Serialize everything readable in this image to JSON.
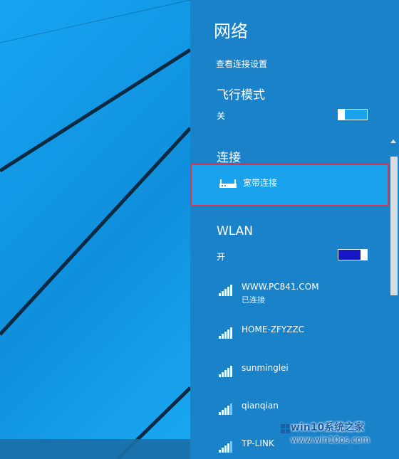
{
  "panel": {
    "title": "网络",
    "settings_link": "查看连接设置",
    "airplane": {
      "title": "飞行模式",
      "state": "关",
      "on": false
    },
    "connections": {
      "title": "连接",
      "item_label": "宽带连接"
    },
    "wlan": {
      "title": "WLAN",
      "state": "开",
      "on": true,
      "networks": [
        {
          "name": "WWW.PC841.COM",
          "status": "已连接",
          "signal_bars": 5
        },
        {
          "name": "HOME-ZFYZZC",
          "status": "",
          "signal_bars": 5
        },
        {
          "name": "sunminglei",
          "status": "",
          "signal_bars": 5
        },
        {
          "name": "qianqian",
          "status": "",
          "signal_bars": 4
        },
        {
          "name": "TP-LINK",
          "status": "",
          "signal_bars": 4
        }
      ]
    }
  },
  "watermark": {
    "brand": "win10系统之家",
    "url": "www.win10os.com"
  },
  "colors": {
    "panel_bg": "#1a82c8",
    "desktop_bg": "#1aa3ee",
    "highlight_bg": "#1ba2ec",
    "highlight_border": "#d8344d",
    "toggle_on": "#1717c6"
  },
  "icons": {
    "router": "router-icon",
    "wifi": "wifi-signal-icon",
    "scroll_up": "chevron-up-icon"
  }
}
